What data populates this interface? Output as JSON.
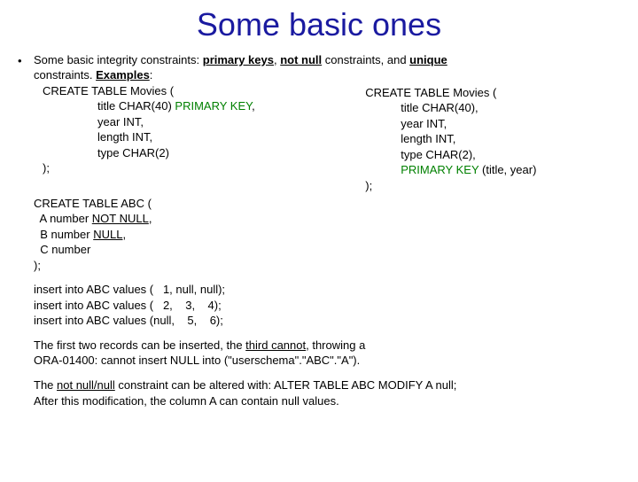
{
  "title": "Some basic ones",
  "bullet": "•",
  "intro1a": "Some basic integrity constraints: ",
  "intro1b": "primary keys",
  "intro1c": ", ",
  "intro1d": "not null",
  "intro1e": " constraints, and ",
  "intro1f": "unique",
  "intro2a": "constraints. ",
  "intro2b": "Examples",
  "intro2c": ":",
  "left": {
    "l1": "CREATE TABLE Movies (",
    "l2a": "title CHAR(40) ",
    "l2b": "PRIMARY KEY",
    "l2c": ",",
    "l3": "year INT,",
    "l4": "length INT,",
    "l5": "type CHAR(2)",
    "l6": ");"
  },
  "right": {
    "r1": "CREATE TABLE Movies (",
    "r2": "title CHAR(40),",
    "r3": "year INT,",
    "r4": "length INT,",
    "r5": "type CHAR(2),",
    "r6a": "PRIMARY KEY",
    "r6b": " (title, year)",
    "r7": ");"
  },
  "abc": {
    "a1": "CREATE TABLE ABC (",
    "a2a": "  A number ",
    "a2b": "NOT NULL",
    "a2c": ",",
    "a3a": "  B number ",
    "a3b": "NULL",
    "a3c": ",",
    "a4": "  C number",
    "a5": ");"
  },
  "ins1": "insert into ABC values (   1, null, null);",
  "ins2": "insert into ABC values (   2,    3,    4);",
  "ins3": "insert into ABC values (null,    5,    6);",
  "p1a": "The first two records can be inserted, the ",
  "p1b": "third cannot",
  "p1c": ", throwing a",
  "p2": "ORA-01400: cannot insert NULL into (\"userschema\".\"ABC\".\"A\").",
  "p3a": "The ",
  "p3b": "not null/null",
  "p3c": " constraint can be altered with: ALTER TABLE ABC MODIFY A null;",
  "p4": "After this modification, the column A can contain null values."
}
